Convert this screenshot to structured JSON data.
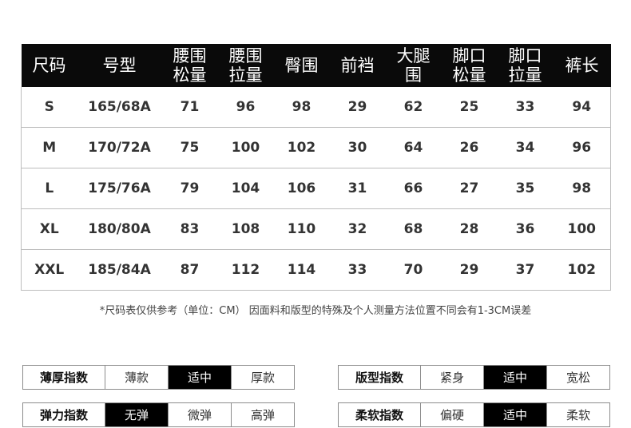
{
  "table": {
    "headers": [
      [
        "尺码"
      ],
      [
        "号型"
      ],
      [
        "腰围",
        "松量"
      ],
      [
        "腰围",
        "拉量"
      ],
      [
        "臀围"
      ],
      [
        "前裆"
      ],
      [
        "大腿",
        "围"
      ],
      [
        "脚口",
        "松量"
      ],
      [
        "脚口",
        "拉量"
      ],
      [
        "裤长"
      ]
    ],
    "rows": [
      [
        "S",
        "165/68A",
        "71",
        "96",
        "98",
        "29",
        "62",
        "25",
        "33",
        "94"
      ],
      [
        "M",
        "170/72A",
        "75",
        "100",
        "102",
        "30",
        "64",
        "26",
        "34",
        "96"
      ],
      [
        "L",
        "175/76A",
        "79",
        "104",
        "106",
        "31",
        "66",
        "27",
        "35",
        "98"
      ],
      [
        "XL",
        "180/80A",
        "83",
        "108",
        "110",
        "32",
        "68",
        "28",
        "36",
        "100"
      ],
      [
        "XXL",
        "185/84A",
        "87",
        "112",
        "114",
        "33",
        "70",
        "29",
        "37",
        "102"
      ]
    ]
  },
  "note": "*尺码表仅供参考（单位：CM） 因面料和版型的特殊及个人测量方法位置不同会有1-3CM误差",
  "indices": [
    {
      "label": "薄厚指数",
      "options": [
        "薄款",
        "适中",
        "厚款"
      ],
      "selected": 1
    },
    {
      "label": "版型指数",
      "options": [
        "紧身",
        "适中",
        "宽松"
      ],
      "selected": 1
    },
    {
      "label": "弹力指数",
      "options": [
        "无弹",
        "微弹",
        "高弹"
      ],
      "selected": 0
    },
    {
      "label": "柔软指数",
      "options": [
        "偏硬",
        "适中",
        "柔软"
      ],
      "selected": 1
    }
  ]
}
